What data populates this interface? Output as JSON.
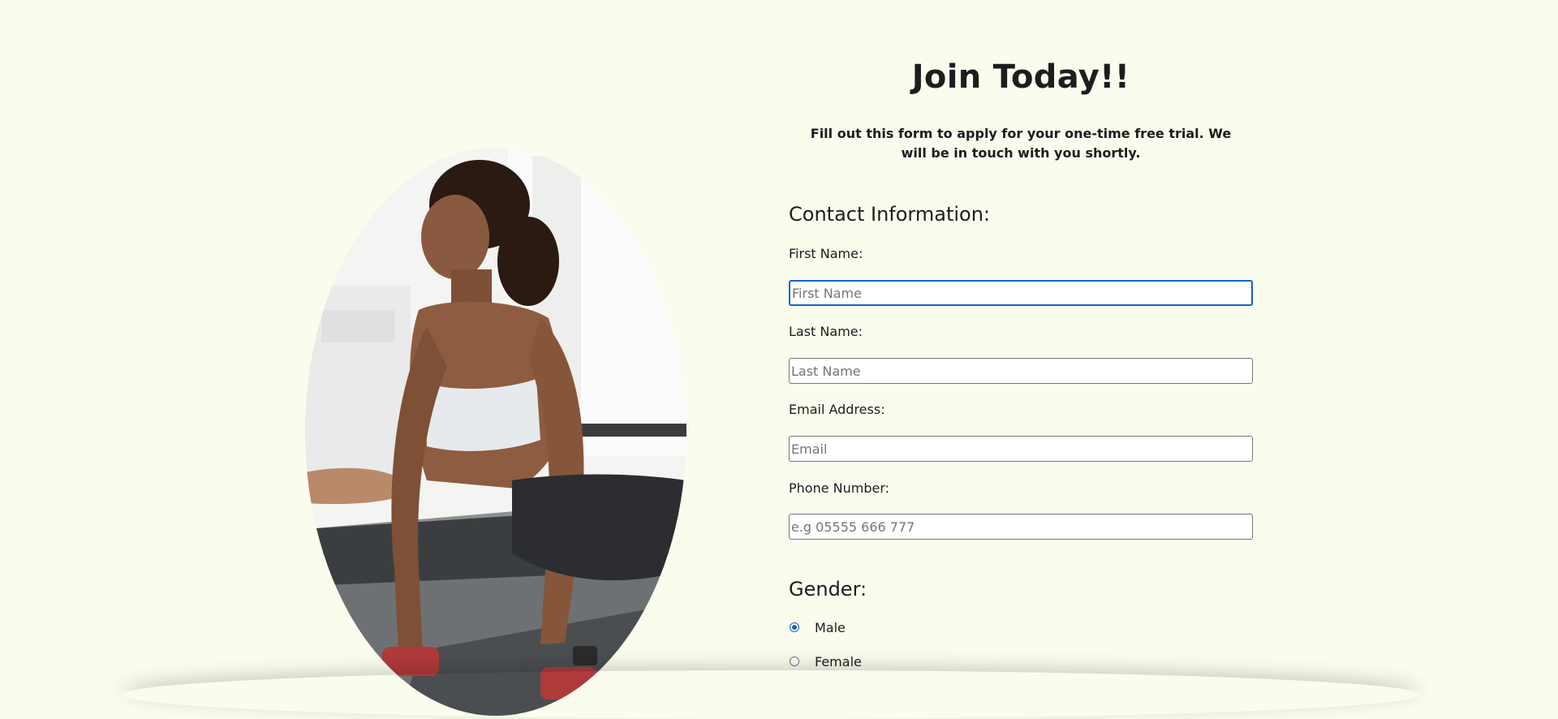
{
  "page": {
    "title": "Join Today!!",
    "intro": "Fill out this form to apply for your one-time free trial. We will be in touch with you shortly."
  },
  "hero_image": {
    "icon": "woman-exercising-image"
  },
  "contact": {
    "heading": "Contact Information:",
    "fields": [
      {
        "label": "First Name:",
        "placeholder": "First Name",
        "value": ""
      },
      {
        "label": "Last Name:",
        "placeholder": "Last Name",
        "value": ""
      },
      {
        "label": "Email Address:",
        "placeholder": "Email",
        "value": ""
      },
      {
        "label": "Phone Number:",
        "placeholder": "e.g 05555 666 777",
        "value": ""
      }
    ]
  },
  "gender": {
    "heading": "Gender:",
    "options": [
      {
        "label": "Male",
        "checked": true
      },
      {
        "label": "Female",
        "checked": false
      }
    ]
  },
  "colors": {
    "background": "#fafcee",
    "text": "#1d1d1d",
    "focus_accent": "#1760c7"
  }
}
